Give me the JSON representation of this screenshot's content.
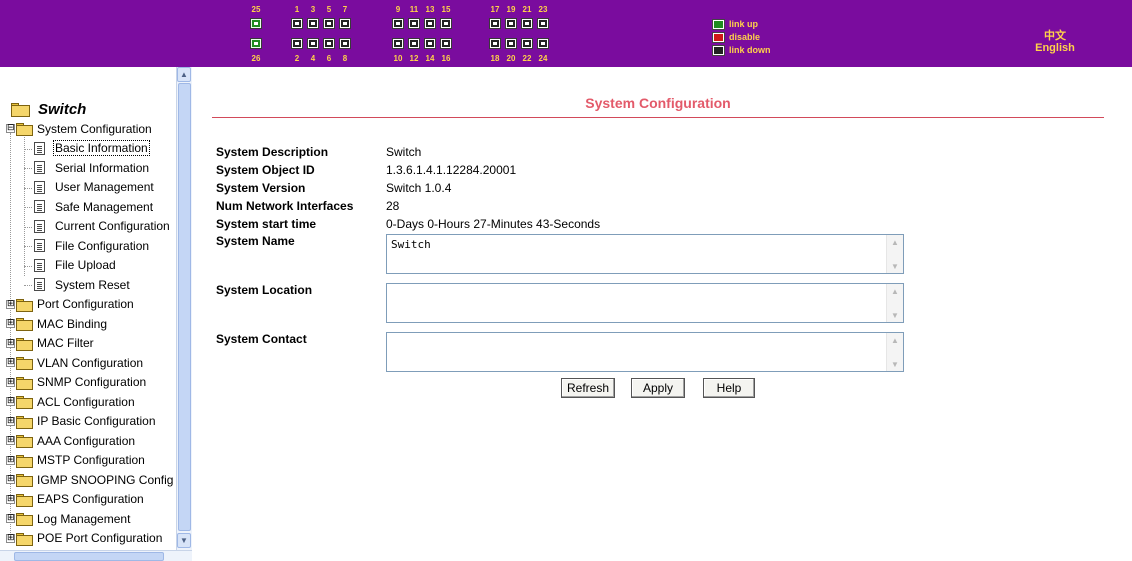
{
  "banner": {
    "port_numbers_top": [
      "25",
      "1",
      "3",
      "5",
      "7",
      "9",
      "11",
      "13",
      "15",
      "17",
      "19",
      "21",
      "23"
    ],
    "port_numbers_bottom": [
      "26",
      "2",
      "4",
      "6",
      "8",
      "10",
      "12",
      "14",
      "16",
      "18",
      "20",
      "22",
      "24"
    ],
    "legend": {
      "link_up": "link up",
      "disable": "disable",
      "link_down": "link down"
    },
    "language": {
      "chinese": "中文",
      "english": "English"
    },
    "colors": {
      "background": "#7a0c9e",
      "label": "#ffd24a",
      "link_up": "#1f8c1f",
      "disable": "#d01818",
      "link_down": "#222222"
    }
  },
  "nav": {
    "root_label": "Switch",
    "items": [
      {
        "label": "System Configuration",
        "expand": "⊟"
      },
      {
        "label": "Basic Information"
      },
      {
        "label": "Serial Information"
      },
      {
        "label": "User Management"
      },
      {
        "label": "Safe Management"
      },
      {
        "label": "Current Configuration"
      },
      {
        "label": "File Configuration"
      },
      {
        "label": "File Upload"
      },
      {
        "label": "System Reset"
      },
      {
        "label": "Port Configuration",
        "expand": "⊞"
      },
      {
        "label": "MAC Binding",
        "expand": "⊞"
      },
      {
        "label": "MAC Filter",
        "expand": "⊞"
      },
      {
        "label": "VLAN Configuration",
        "expand": "⊞"
      },
      {
        "label": "SNMP Configuration",
        "expand": "⊞"
      },
      {
        "label": "ACL Configuration",
        "expand": "⊞"
      },
      {
        "label": "IP Basic Configuration",
        "expand": "⊞"
      },
      {
        "label": "AAA Configuration",
        "expand": "⊞"
      },
      {
        "label": "MSTP Configuration",
        "expand": "⊞"
      },
      {
        "label": "IGMP SNOOPING Config",
        "expand": "⊞"
      },
      {
        "label": "EAPS Configuration",
        "expand": "⊞"
      },
      {
        "label": "Log Management",
        "expand": "⊞"
      },
      {
        "label": "POE Port Configuration",
        "expand": "⊞"
      }
    ]
  },
  "main": {
    "title": "System Configuration",
    "fields": {
      "description": {
        "label": "System Description",
        "value": "Switch"
      },
      "object_id": {
        "label": "System Object ID",
        "value": "1.3.6.1.4.1.12284.20001"
      },
      "version": {
        "label": "System Version",
        "value": "Switch 1.0.4"
      },
      "num_interfaces": {
        "label": "Num Network Interfaces",
        "value": "28"
      },
      "start_time": {
        "label": "System start time",
        "value": "0-Days 0-Hours 27-Minutes 43-Seconds"
      },
      "name": {
        "label": "System Name",
        "value": "Switch"
      },
      "location": {
        "label": "System Location",
        "value": ""
      },
      "contact": {
        "label": "System Contact",
        "value": ""
      }
    },
    "buttons": {
      "refresh": "Refresh",
      "apply": "Apply",
      "help": "Help"
    }
  }
}
